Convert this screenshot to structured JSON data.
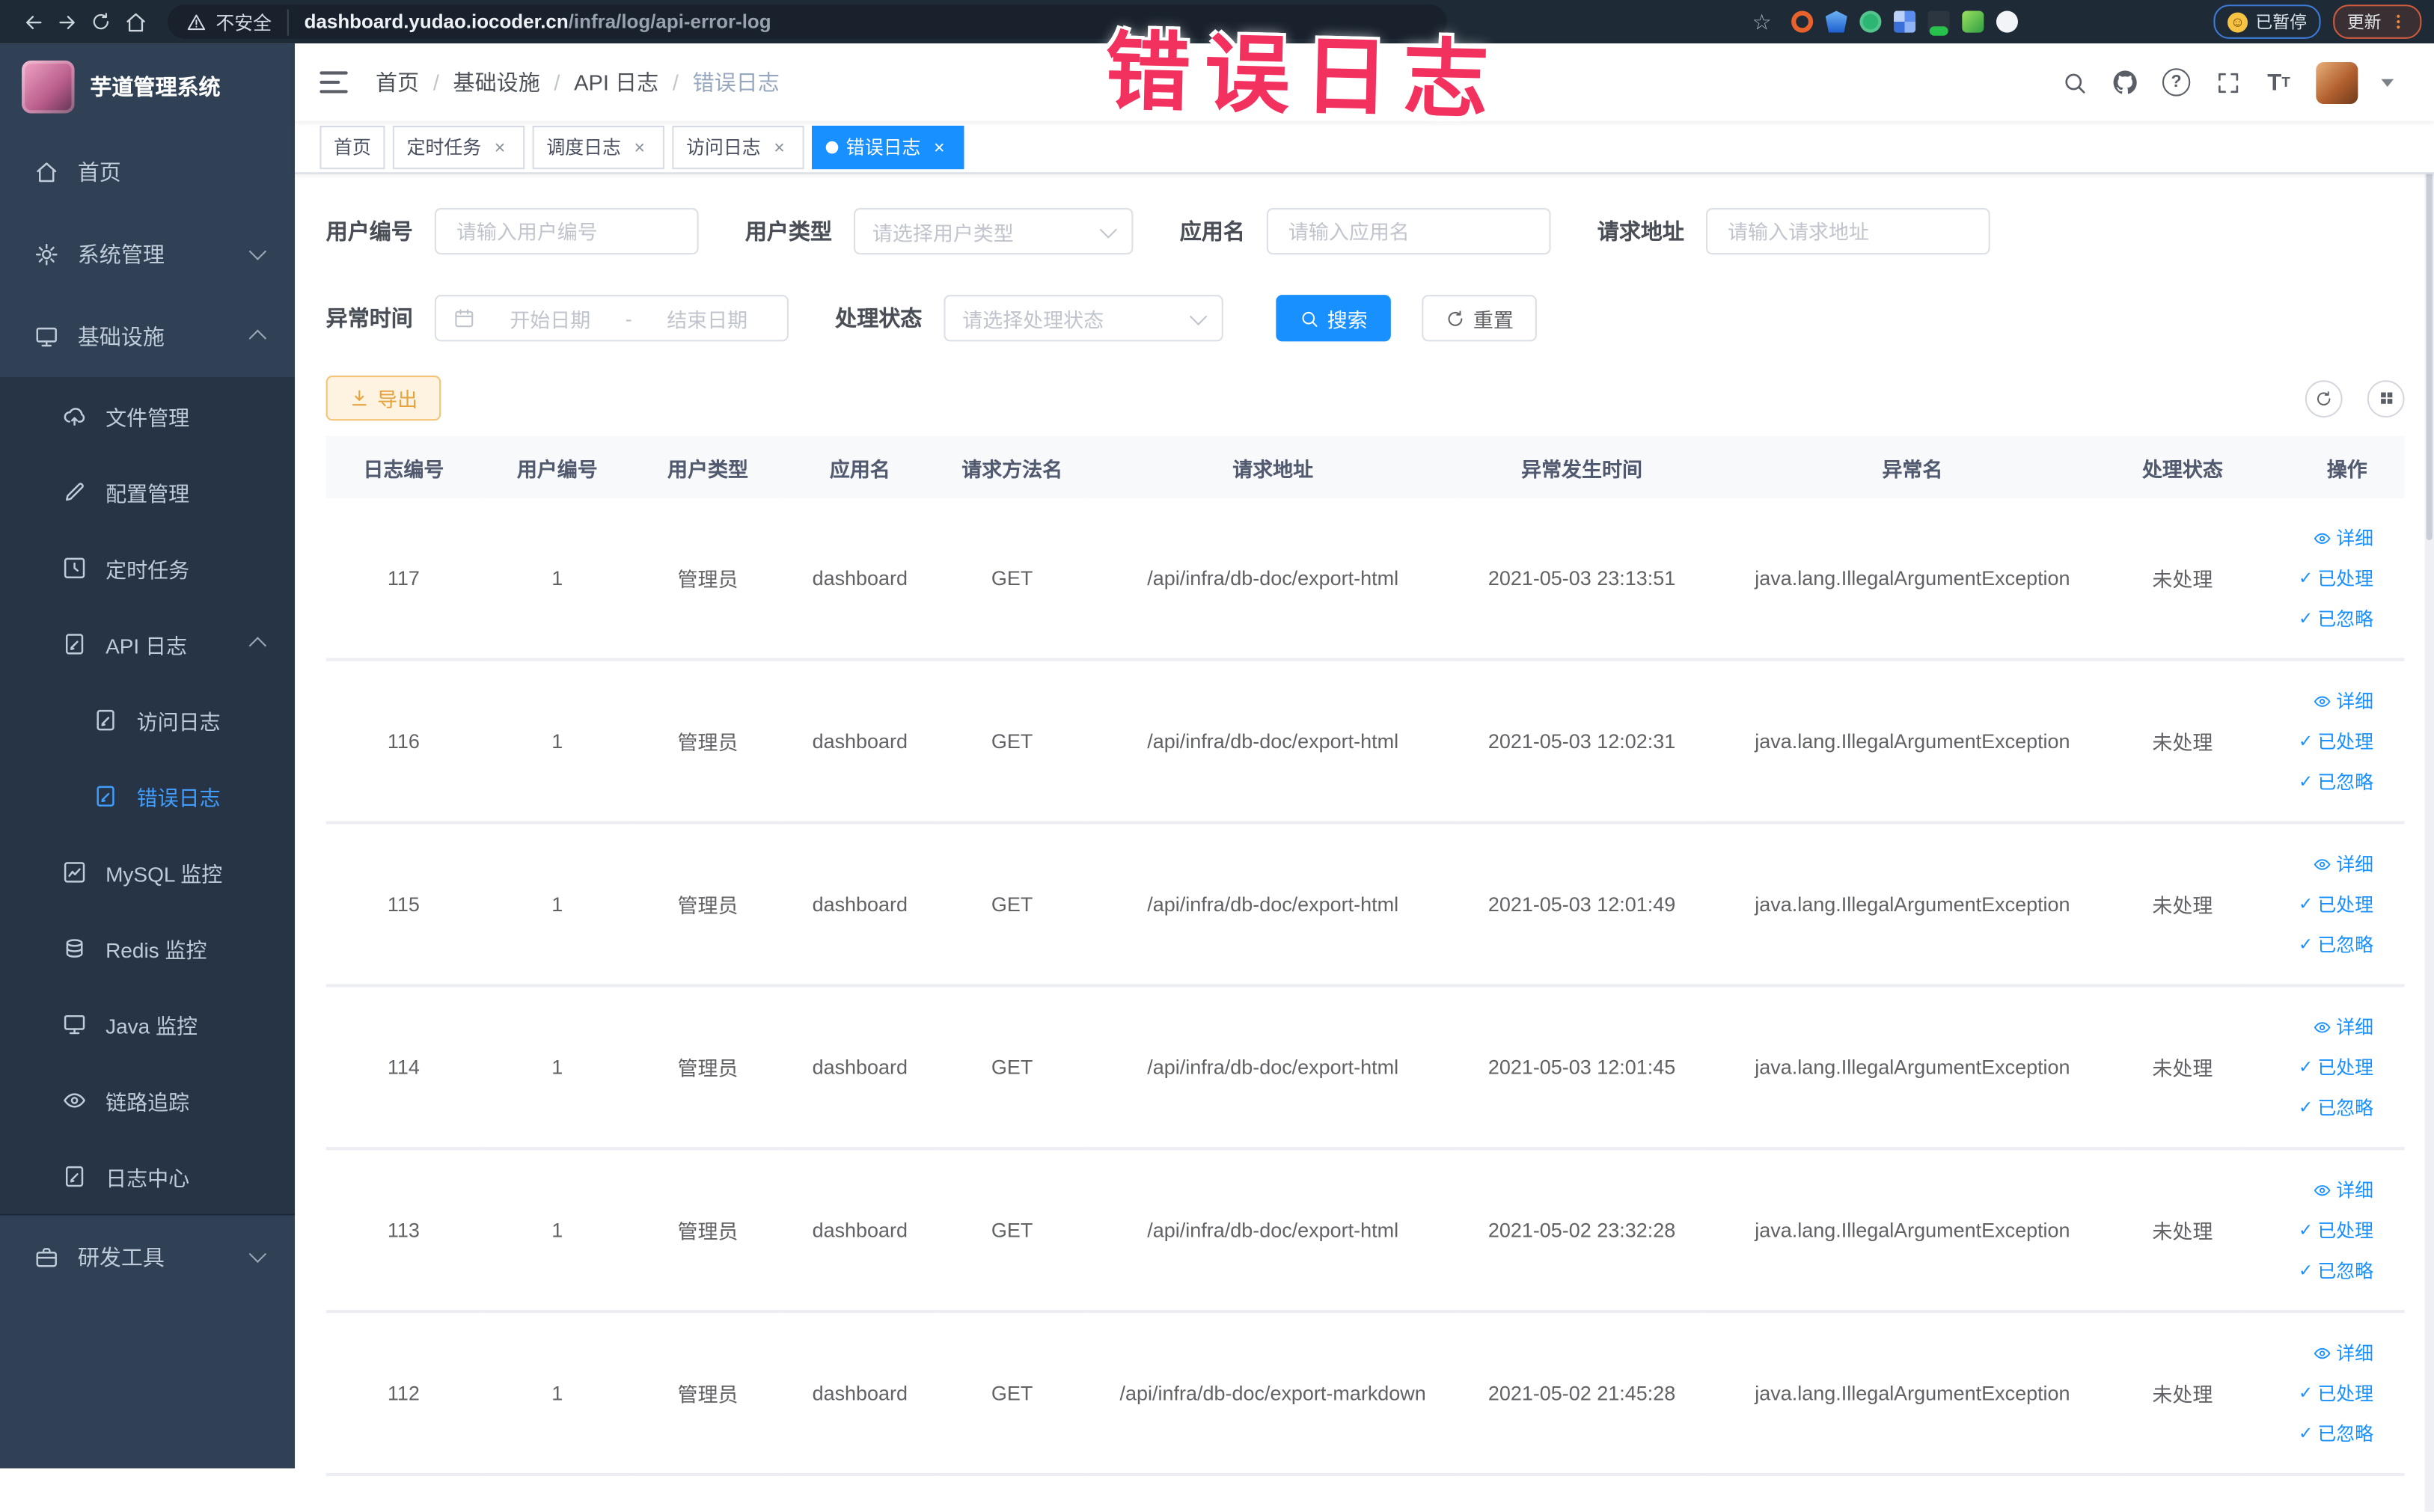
{
  "browser": {
    "security_text": "不安全",
    "url_domain": "dashboard.yudao.iocoder.cn",
    "url_path": "/infra/log/api-error-log",
    "paused_label": "已暂停",
    "update_label": "更新"
  },
  "annotation": {
    "text": "错误日志",
    "color": "#f3315f"
  },
  "sidebar": {
    "title": "芋道管理系统",
    "items": [
      {
        "label": "首页",
        "level": 0
      },
      {
        "label": "系统管理",
        "level": 0,
        "chevron": "down"
      },
      {
        "label": "基础设施",
        "level": 0,
        "chevron": "up"
      },
      {
        "label": "文件管理",
        "level": 1
      },
      {
        "label": "配置管理",
        "level": 1
      },
      {
        "label": "定时任务",
        "level": 1
      },
      {
        "label": "API 日志",
        "level": 1,
        "chevron": "up"
      },
      {
        "label": "访问日志",
        "level": 2
      },
      {
        "label": "错误日志",
        "level": 2,
        "active": true
      },
      {
        "label": "MySQL 监控",
        "level": 1
      },
      {
        "label": "Redis 监控",
        "level": 1
      },
      {
        "label": "Java 监控",
        "level": 1
      },
      {
        "label": "链路追踪",
        "level": 1
      },
      {
        "label": "日志中心",
        "level": 1
      },
      {
        "label": "研发工具",
        "level": 0,
        "chevron": "down"
      }
    ]
  },
  "header": {
    "breadcrumb": [
      "首页",
      "基础设施",
      "API 日志",
      "错误日志"
    ],
    "separator": "/"
  },
  "tabs": [
    {
      "label": "首页",
      "closable": false,
      "active": false
    },
    {
      "label": "定时任务",
      "closable": true,
      "active": false
    },
    {
      "label": "调度日志",
      "closable": true,
      "active": false
    },
    {
      "label": "访问日志",
      "closable": true,
      "active": false
    },
    {
      "label": "错误日志",
      "closable": true,
      "active": true
    }
  ],
  "filters": {
    "user_id": {
      "label": "用户编号",
      "placeholder": "请输入用户编号",
      "value": ""
    },
    "user_type": {
      "label": "用户类型",
      "placeholder": "请选择用户类型"
    },
    "app_name": {
      "label": "应用名",
      "placeholder": "请输入应用名",
      "value": ""
    },
    "request_url": {
      "label": "请求地址",
      "placeholder": "请输入请求地址",
      "value": ""
    },
    "exception_time": {
      "label": "异常时间",
      "start_placeholder": "开始日期",
      "separator": "-",
      "end_placeholder": "结束日期"
    },
    "process_status": {
      "label": "处理状态",
      "placeholder": "请选择处理状态"
    },
    "search_label": "搜索",
    "reset_label": "重置"
  },
  "toolbar": {
    "export_label": "导出"
  },
  "table": {
    "columns": [
      "日志编号",
      "用户编号",
      "用户类型",
      "应用名",
      "请求方法名",
      "请求地址",
      "异常发生时间",
      "异常名",
      "处理状态",
      "操作"
    ],
    "row_actions": [
      "详细",
      "已处理",
      "已忽略"
    ],
    "rows": [
      {
        "id": "117",
        "user_id": "1",
        "user_type": "管理员",
        "app": "dashboard",
        "method": "GET",
        "url": "/api/infra/db-doc/export-html",
        "time": "2021-05-03 23:13:51",
        "exception": "java.lang.IllegalArgumentException",
        "status": "未处理"
      },
      {
        "id": "116",
        "user_id": "1",
        "user_type": "管理员",
        "app": "dashboard",
        "method": "GET",
        "url": "/api/infra/db-doc/export-html",
        "time": "2021-05-03 12:02:31",
        "exception": "java.lang.IllegalArgumentException",
        "status": "未处理"
      },
      {
        "id": "115",
        "user_id": "1",
        "user_type": "管理员",
        "app": "dashboard",
        "method": "GET",
        "url": "/api/infra/db-doc/export-html",
        "time": "2021-05-03 12:01:49",
        "exception": "java.lang.IllegalArgumentException",
        "status": "未处理"
      },
      {
        "id": "114",
        "user_id": "1",
        "user_type": "管理员",
        "app": "dashboard",
        "method": "GET",
        "url": "/api/infra/db-doc/export-html",
        "time": "2021-05-03 12:01:45",
        "exception": "java.lang.IllegalArgumentException",
        "status": "未处理"
      },
      {
        "id": "113",
        "user_id": "1",
        "user_type": "管理员",
        "app": "dashboard",
        "method": "GET",
        "url": "/api/infra/db-doc/export-html",
        "time": "2021-05-02 23:32:28",
        "exception": "java.lang.IllegalArgumentException",
        "status": "未处理"
      },
      {
        "id": "112",
        "user_id": "1",
        "user_type": "管理员",
        "app": "dashboard",
        "method": "GET",
        "url": "/api/infra/db-doc/export-markdown",
        "time": "2021-05-02 21:45:28",
        "exception": "java.lang.IllegalArgumentException",
        "status": "未处理"
      }
    ]
  },
  "colors": {
    "primary": "#1890ff",
    "sidebar_bg": "#304156",
    "submenu_bg": "#263445",
    "sidebar_active": "#409eff",
    "warning_button": "#e6a23c",
    "annotation_red": "#f3315f",
    "browser_bar": "#1e2a36"
  }
}
